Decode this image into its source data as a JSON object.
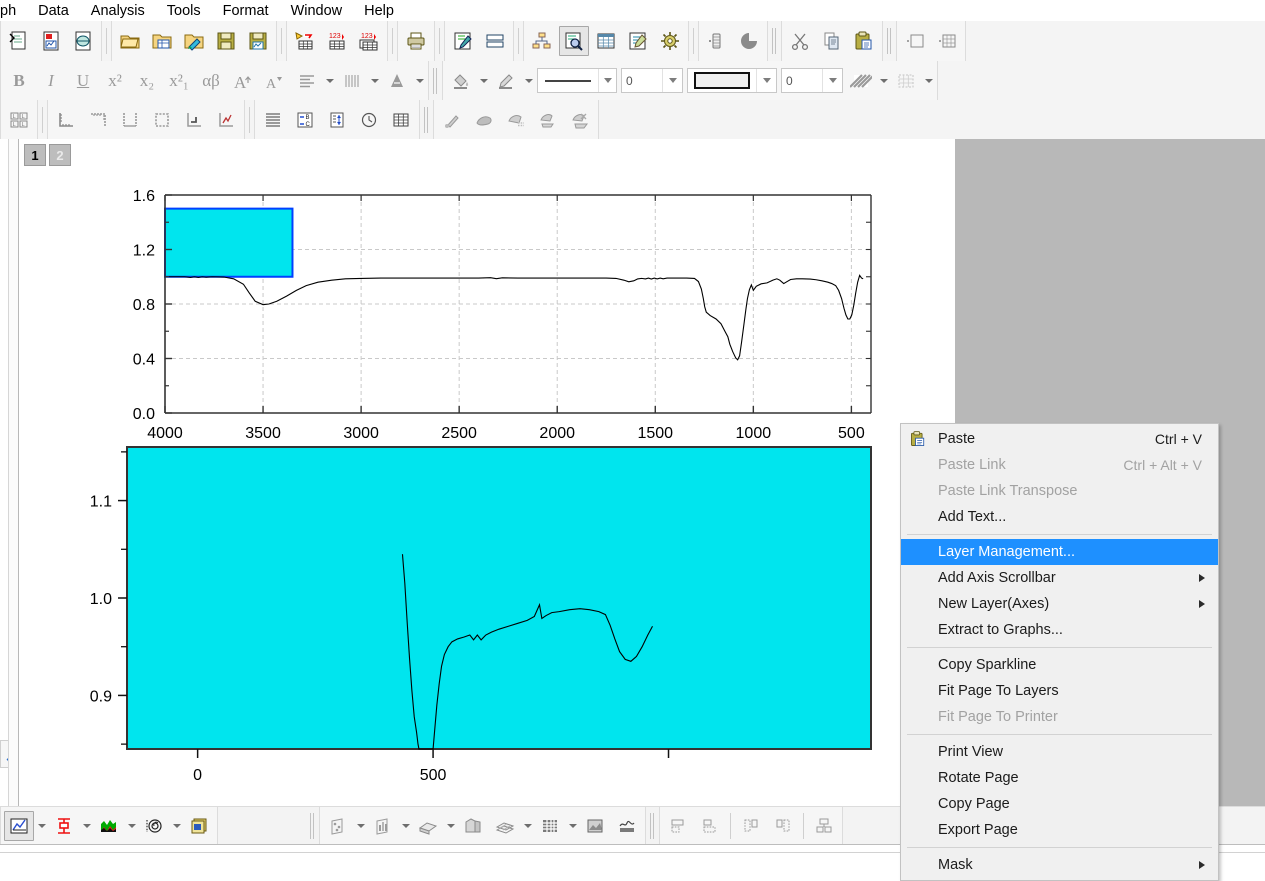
{
  "menubar": {
    "items": [
      {
        "label": "ph",
        "name": "menu-graph"
      },
      {
        "label": "Data",
        "name": "menu-data"
      },
      {
        "label": "Analysis",
        "name": "menu-analysis"
      },
      {
        "label": "Tools",
        "name": "menu-tools"
      },
      {
        "label": "Format",
        "name": "menu-format"
      },
      {
        "label": "Window",
        "name": "menu-window"
      },
      {
        "label": "Help",
        "name": "menu-help"
      }
    ]
  },
  "toolbars": {
    "standard": [
      "new-project-icon",
      "new-graph-icon",
      "new-folder-icon",
      "open-icon",
      "open-excel-icon",
      "open-template-icon",
      "save-project-icon",
      "save-template-icon",
      "import-wizard-icon",
      "import-single-ascii-icon",
      "import-multiple-ascii-icon",
      "print-icon",
      "edit-mode-icon",
      "layout-icon",
      "tree-icon",
      "zoom-in-icon",
      "new-worksheet-icon",
      "new-notes-icon",
      "settings-icon",
      "refresh-icon",
      "pie-icon",
      "cut-icon",
      "copy-icon",
      "paste-icon",
      "add-layer-icon",
      "add-table-icon"
    ],
    "format": {
      "bold": "B",
      "italic": "I",
      "underline": "U",
      "superscript": "x²",
      "subscript": "x₂",
      "supersub": "x²₁",
      "greek": "αβ",
      "increase-font": "A",
      "decrease-font": "A",
      "align-icon": "align-icon",
      "tick-icon": "tick-icon",
      "font-color-icon": "font-color-icon",
      "fill-color-icon": "fill-color-icon",
      "line-color-icon": "line-color-icon",
      "line_style_value": "",
      "line_width_value": "0",
      "fill_pattern_value": "",
      "fill_width_value": "0",
      "pattern-icon": "pattern-icon",
      "grid-icon": "grid-icon"
    },
    "graph": [
      "layer-contents-icon",
      "axis-bottom-left-icon",
      "axis-top-right-icon",
      "axis-left-right-icon",
      "axis-frame-icon",
      "axis-step-icon",
      "axis-scale-icon",
      "stack-lines-icon",
      "exchange-icon",
      "extract-icon",
      "clock-icon",
      "grid-table-icon",
      "mask-point-icon",
      "mask-range-icon",
      "hide-point-icon",
      "swap-icon",
      "clear-mask-icon"
    ],
    "bottom": [
      "plot-setup-icon",
      "error-bar-icon",
      "area-fill-icon",
      "image-profile-icon",
      "gallery-icon",
      "scatter-3d-icon",
      "bar-3d-icon",
      "surface-3d-icon",
      "wall-3d-icon",
      "wire-3d-icon",
      "matrix-3d-icon",
      "image-3d-icon",
      "contour-3d-icon",
      "align-top-icon",
      "align-bottom-icon",
      "align-left-icon",
      "align-right-icon",
      "align-center-icon"
    ]
  },
  "workspace": {
    "layer_tabs": [
      {
        "label": "1",
        "active": true,
        "name": "layer-tab-1"
      },
      {
        "label": "2",
        "active": false,
        "name": "layer-tab-2"
      }
    ],
    "wrench_icon": "wrench-icon"
  },
  "chart_data": [
    {
      "type": "line",
      "name": "upper-layer",
      "title": "",
      "xlabel": "",
      "ylabel": "",
      "xlim": [
        4000,
        400
      ],
      "ylim": [
        0.0,
        1.6
      ],
      "x_ticks": [
        4000,
        3500,
        3000,
        2500,
        2000,
        1500,
        1000,
        500
      ],
      "y_ticks": [
        "0.0",
        "0.4",
        "0.8",
        "1.2",
        "1.6"
      ],
      "x_reversed": true,
      "grid": "dashed-both",
      "line_color": "#000000",
      "selection_rect": {
        "x0": 4000,
        "x1": 3350,
        "y0": 1.0,
        "y1": 1.5,
        "fill": "#00E5EE",
        "stroke": "#0040FF"
      },
      "points": [
        [
          4000,
          1.0
        ],
        [
          3950,
          1.0
        ],
        [
          3900,
          1.0
        ],
        [
          3870,
          0.995
        ],
        [
          3850,
          1.0
        ],
        [
          3830,
          0.995
        ],
        [
          3810,
          1.0
        ],
        [
          3790,
          0.997
        ],
        [
          3760,
          1.0
        ],
        [
          3700,
          0.998
        ],
        [
          3650,
          0.985
        ],
        [
          3600,
          0.945
        ],
        [
          3570,
          0.88
        ],
        [
          3540,
          0.82
        ],
        [
          3500,
          0.795
        ],
        [
          3470,
          0.8
        ],
        [
          3430,
          0.82
        ],
        [
          3380,
          0.858
        ],
        [
          3330,
          0.9
        ],
        [
          3280,
          0.935
        ],
        [
          3220,
          0.96
        ],
        [
          3150,
          0.975
        ],
        [
          3080,
          0.985
        ],
        [
          3000,
          0.988
        ],
        [
          2900,
          0.99
        ],
        [
          2800,
          0.99
        ],
        [
          2700,
          0.99
        ],
        [
          2600,
          0.99
        ],
        [
          2500,
          0.99
        ],
        [
          2400,
          0.99
        ],
        [
          2340,
          0.993
        ],
        [
          2310,
          0.986
        ],
        [
          2280,
          0.992
        ],
        [
          2200,
          0.99
        ],
        [
          2100,
          0.99
        ],
        [
          2000,
          0.99
        ],
        [
          1900,
          0.99
        ],
        [
          1800,
          0.99
        ],
        [
          1750,
          0.99
        ],
        [
          1700,
          0.988
        ],
        [
          1660,
          0.975
        ],
        [
          1635,
          0.963
        ],
        [
          1610,
          0.97
        ],
        [
          1590,
          0.984
        ],
        [
          1570,
          0.988
        ],
        [
          1550,
          0.984
        ],
        [
          1535,
          0.99
        ],
        [
          1520,
          0.983
        ],
        [
          1505,
          0.99
        ],
        [
          1490,
          0.984
        ],
        [
          1475,
          0.99
        ],
        [
          1460,
          0.985
        ],
        [
          1440,
          0.99
        ],
        [
          1400,
          0.99
        ],
        [
          1340,
          0.99
        ],
        [
          1300,
          0.988
        ],
        [
          1280,
          0.965
        ],
        [
          1265,
          0.91
        ],
        [
          1255,
          0.84
        ],
        [
          1248,
          0.78
        ],
        [
          1240,
          0.74
        ],
        [
          1220,
          0.715
        ],
        [
          1190,
          0.69
        ],
        [
          1165,
          0.655
        ],
        [
          1145,
          0.6
        ],
        [
          1130,
          0.56
        ],
        [
          1120,
          0.505
        ],
        [
          1105,
          0.45
        ],
        [
          1090,
          0.405
        ],
        [
          1080,
          0.39
        ],
        [
          1070,
          0.42
        ],
        [
          1060,
          0.52
        ],
        [
          1048,
          0.65
        ],
        [
          1038,
          0.76
        ],
        [
          1030,
          0.84
        ],
        [
          1020,
          0.905
        ],
        [
          1010,
          0.94
        ],
        [
          1000,
          0.9
        ],
        [
          985,
          0.93
        ],
        [
          960,
          0.948
        ],
        [
          930,
          0.955
        ],
        [
          900,
          0.975
        ],
        [
          880,
          0.985
        ],
        [
          865,
          0.975
        ],
        [
          845,
          0.95
        ],
        [
          830,
          0.963
        ],
        [
          810,
          0.98
        ],
        [
          780,
          0.985
        ],
        [
          750,
          0.985
        ],
        [
          710,
          0.983
        ],
        [
          680,
          0.978
        ],
        [
          650,
          0.97
        ],
        [
          620,
          0.96
        ],
        [
          600,
          0.95
        ],
        [
          580,
          0.935
        ],
        [
          565,
          0.9
        ],
        [
          550,
          0.84
        ],
        [
          538,
          0.77
        ],
        [
          528,
          0.72
        ],
        [
          518,
          0.69
        ],
        [
          508,
          0.69
        ],
        [
          498,
          0.72
        ],
        [
          488,
          0.79
        ],
        [
          478,
          0.88
        ],
        [
          468,
          0.96
        ],
        [
          458,
          1.01
        ],
        [
          448,
          0.99
        ],
        [
          440,
          0.985
        ]
      ]
    },
    {
      "type": "line",
      "name": "lower-layer",
      "title": "",
      "xlabel": "",
      "ylabel": "",
      "xlim": [
        -150,
        1430
      ],
      "ylim": [
        0.845,
        1.155
      ],
      "x_ticks": [
        0,
        500
      ],
      "y_ticks": [
        "0.9",
        "1.0",
        "1.1"
      ],
      "background": "#00E5EE",
      "line_color": "#000000",
      "grid": "none",
      "points": [
        [
          435,
          1.045
        ],
        [
          440,
          1.015
        ],
        [
          445,
          0.975
        ],
        [
          450,
          0.938
        ],
        [
          455,
          0.905
        ],
        [
          460,
          0.878
        ],
        [
          465,
          0.862
        ],
        [
          468,
          0.85
        ],
        [
          470,
          0.845
        ],
        [
          500,
          0.845
        ],
        [
          503,
          0.862
        ],
        [
          508,
          0.89
        ],
        [
          513,
          0.912
        ],
        [
          518,
          0.93
        ],
        [
          524,
          0.942
        ],
        [
          532,
          0.95
        ],
        [
          540,
          0.955
        ],
        [
          552,
          0.958
        ],
        [
          566,
          0.96
        ],
        [
          578,
          0.962
        ],
        [
          586,
          0.957
        ],
        [
          594,
          0.962
        ],
        [
          602,
          0.957
        ],
        [
          612,
          0.962
        ],
        [
          624,
          0.965
        ],
        [
          640,
          0.968
        ],
        [
          660,
          0.971
        ],
        [
          680,
          0.974
        ],
        [
          700,
          0.977
        ],
        [
          715,
          0.981
        ],
        [
          726,
          0.993
        ],
        [
          731,
          0.979
        ],
        [
          740,
          0.982
        ],
        [
          752,
          0.985
        ],
        [
          768,
          0.986
        ],
        [
          790,
          0.988
        ],
        [
          812,
          0.989
        ],
        [
          832,
          0.988
        ],
        [
          852,
          0.986
        ],
        [
          866,
          0.983
        ],
        [
          876,
          0.972
        ],
        [
          886,
          0.958
        ],
        [
          896,
          0.945
        ],
        [
          908,
          0.937
        ],
        [
          920,
          0.935
        ],
        [
          932,
          0.94
        ],
        [
          944,
          0.95
        ],
        [
          956,
          0.962
        ],
        [
          966,
          0.971
        ]
      ]
    }
  ],
  "context_menu": {
    "name": "graph-context-menu",
    "items": [
      {
        "label": "Paste",
        "accel": "Ctrl + V",
        "icon": "paste-icon",
        "disabled": false,
        "submenu": false,
        "highlight": false
      },
      {
        "label": "Paste Link",
        "accel": "Ctrl + Alt + V",
        "icon": "",
        "disabled": true,
        "submenu": false,
        "highlight": false
      },
      {
        "label": "Paste Link Transpose",
        "accel": "",
        "icon": "",
        "disabled": true,
        "submenu": false,
        "highlight": false
      },
      {
        "label": "Add Text...",
        "accel": "",
        "icon": "",
        "disabled": false,
        "submenu": false,
        "highlight": false
      },
      {
        "separator": true
      },
      {
        "label": "Layer Management...",
        "accel": "",
        "icon": "",
        "disabled": false,
        "submenu": false,
        "highlight": true
      },
      {
        "label": "Add Axis Scrollbar",
        "accel": "",
        "icon": "",
        "disabled": false,
        "submenu": true,
        "highlight": false
      },
      {
        "label": "New Layer(Axes)",
        "accel": "",
        "icon": "",
        "disabled": false,
        "submenu": true,
        "highlight": false
      },
      {
        "label": "Extract to Graphs...",
        "accel": "",
        "icon": "",
        "disabled": false,
        "submenu": false,
        "highlight": false
      },
      {
        "separator": true
      },
      {
        "label": "Copy Sparkline",
        "accel": "",
        "icon": "",
        "disabled": false,
        "submenu": false,
        "highlight": false
      },
      {
        "label": "Fit Page To Layers",
        "accel": "",
        "icon": "",
        "disabled": false,
        "submenu": false,
        "highlight": false
      },
      {
        "label": "Fit Page To Printer",
        "accel": "",
        "icon": "",
        "disabled": true,
        "submenu": false,
        "highlight": false
      },
      {
        "separator": true
      },
      {
        "label": "Print View",
        "accel": "",
        "icon": "",
        "disabled": false,
        "submenu": false,
        "highlight": false
      },
      {
        "label": "Rotate Page",
        "accel": "",
        "icon": "",
        "disabled": false,
        "submenu": false,
        "highlight": false
      },
      {
        "label": "Copy Page",
        "accel": "",
        "icon": "",
        "disabled": false,
        "submenu": false,
        "highlight": false
      },
      {
        "label": "Export Page",
        "accel": "",
        "icon": "",
        "disabled": false,
        "submenu": false,
        "highlight": false
      },
      {
        "separator": true
      },
      {
        "label": "Mask",
        "accel": "",
        "icon": "",
        "disabled": false,
        "submenu": true,
        "highlight": false
      }
    ]
  },
  "colors": {
    "accent": "#1e90ff",
    "cyan_fill": "#00E5EE",
    "selection_stroke": "#0040FF",
    "toolbar_bg": "#f4f4f4",
    "workspace_bg": "#b8b8b8"
  }
}
